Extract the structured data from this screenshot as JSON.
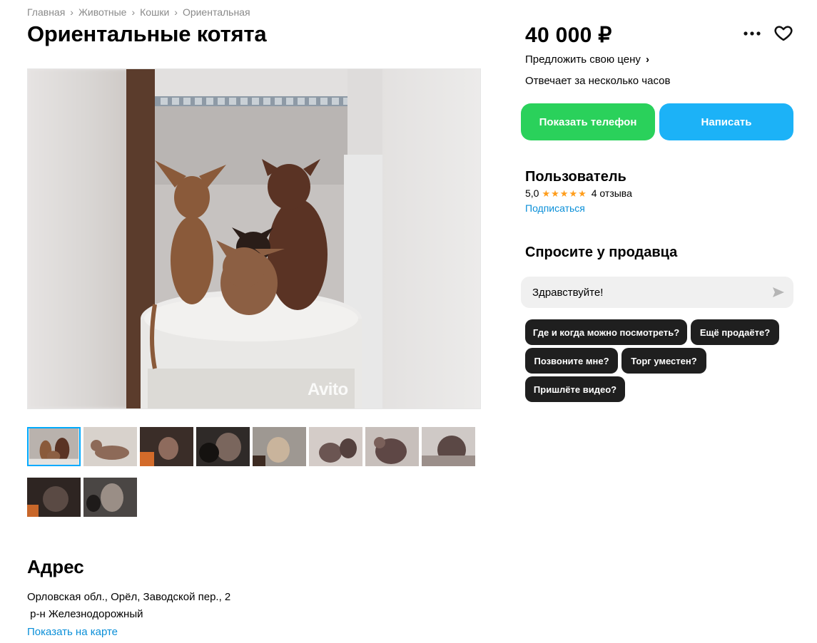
{
  "breadcrumb": {
    "items": [
      "Главная",
      "Животные",
      "Кошки",
      "Ориентальная"
    ],
    "separator": "›"
  },
  "title": "Ориентальные котята",
  "gallery": {
    "watermark": "Avito",
    "thumbnail_count": 10,
    "active_index": 0
  },
  "address": {
    "heading": "Адрес",
    "line1": "Орловская обл., Орёл, Заводской пер., 2",
    "line2": " р-н Железнодорожный",
    "map_link": "Показать на карте"
  },
  "listing": {
    "price": "40 000 ₽",
    "offer_price": "Предложить свою цену",
    "reply_time": "Отвечает за несколько часов",
    "more_icon": "more-dots-icon",
    "favorite_icon": "heart-icon"
  },
  "actions": {
    "show_phone": "Показать телефон",
    "write": "Написать",
    "phone_color": "#2ad15b",
    "write_color": "#1cb2f7"
  },
  "seller": {
    "name": "Пользователь",
    "rating": "5,0",
    "stars": 5,
    "reviews": "4 отзыва",
    "subscribe": "Подписаться"
  },
  "ask": {
    "heading": "Спросите у продавца",
    "message_value": "Здравствуйте!",
    "send_icon": "send-icon",
    "quick_questions": [
      "Где и когда можно посмотреть?",
      "Ещё продаёте?",
      "Позвоните мне?",
      "Торг уместен?",
      "Пришлёте видео?"
    ]
  },
  "colors": {
    "link": "#0a8fd8",
    "star": "#ff9d1b",
    "chip": "#1f1f1f",
    "active_thumb_border": "#00aaff"
  }
}
